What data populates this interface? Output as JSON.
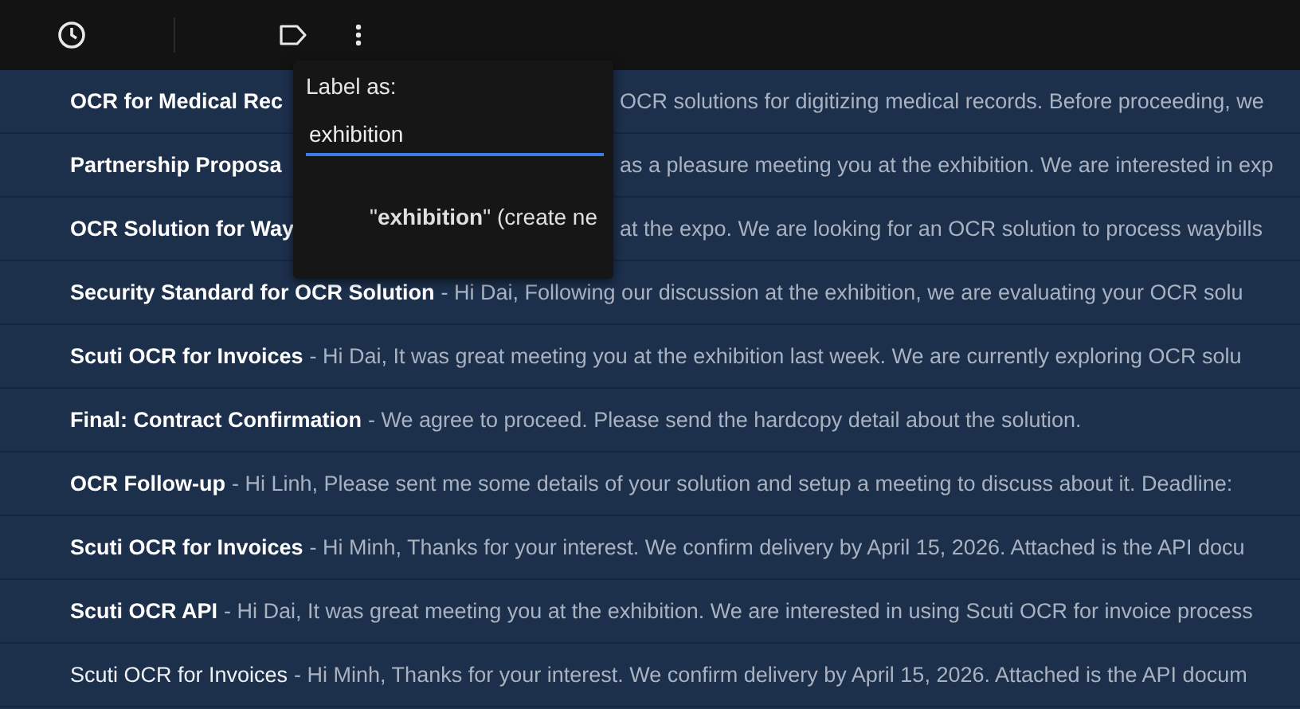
{
  "toolbar": {
    "buttons": [
      {
        "kind": "snooze"
      },
      {
        "kind": "divider"
      },
      {
        "kind": "label"
      },
      {
        "kind": "more"
      }
    ]
  },
  "label_menu": {
    "title": "Label as:",
    "input_value": "exhibition",
    "option": "\"**exhibition**\" (create ne"
  },
  "messages": [
    {
      "kind": "covered",
      "unread": true,
      "subject": "OCR for Medical Rec",
      "tail": "OCR solutions for digitizing medical records. Before proceeding, we"
    },
    {
      "kind": "covered",
      "unread": true,
      "subject": "Partnership Proposa",
      "tail": "as a pleasure meeting you at the exhibition. We are interested in exp"
    },
    {
      "kind": "covered",
      "unread": true,
      "subject": "OCR Solution for Way",
      "tail": "at the expo. We are looking for an OCR solution to process waybills"
    },
    {
      "kind": "full",
      "unread": true,
      "subject": "Security Standard for OCR Solution",
      "snippet": "- Hi Dai, Following our discussion at the exhibition, we are evaluating your OCR solu"
    },
    {
      "kind": "full",
      "unread": true,
      "subject": "Scuti OCR for Invoices",
      "snippet": "- Hi Dai, It was great meeting you at the exhibition last week. We are currently exploring OCR solu"
    },
    {
      "kind": "full",
      "unread": true,
      "subject": "Final: Contract Confirmation",
      "snippet": "- We agree to proceed. Please send the hardcopy detail about the solution."
    },
    {
      "kind": "full",
      "unread": true,
      "subject": "OCR Follow-up",
      "snippet": "- Hi Linh, Please sent me some details of your solution and setup a meeting to discuss about it. Deadline:"
    },
    {
      "kind": "full",
      "unread": true,
      "subject": "Scuti OCR for Invoices",
      "snippet": "- Hi Minh, Thanks for your interest. We confirm delivery by April 15, 2026. Attached is the API docu"
    },
    {
      "kind": "full",
      "unread": true,
      "subject": "Scuti OCR API",
      "snippet": "- Hi Dai, It was great meeting you at the exhibition. We are interested in using Scuti OCR for invoice process"
    },
    {
      "kind": "full",
      "unread": false,
      "subject": "Scuti OCR for Invoices",
      "snippet": "- Hi Minh, Thanks for your interest. We confirm delivery by April 15, 2026. Attached is the API docum"
    }
  ]
}
